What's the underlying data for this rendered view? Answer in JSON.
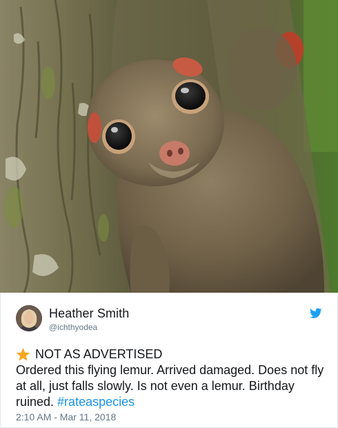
{
  "tweet": {
    "author_name": "Heather Smith",
    "handle": "@ichthyodea",
    "headline": "NOT AS ADVERTISED",
    "body_text": "Ordered this flying lemur. Arrived damaged. Does not fly at all, just falls slowly. Is not even a lemur. Birthday ruined. ",
    "hashtag": "#rateaspecies",
    "timestamp": "2:10 AM - Mar 11, 2018"
  },
  "icons": {
    "brand": "twitter-bird-icon",
    "headline_icon": "star-icon"
  },
  "colors": {
    "hashtag": "#1b95e0",
    "twitter_brand": "#1da1f2",
    "star": "#f5a623",
    "secondary_text": "#657786"
  }
}
